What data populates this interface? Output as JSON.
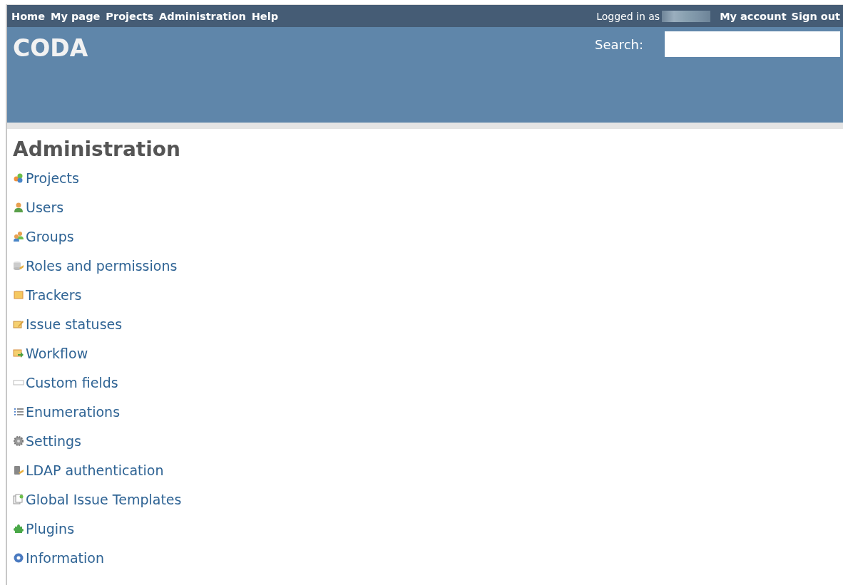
{
  "top_menu": {
    "links": [
      "Home",
      "My page",
      "Projects",
      "Administration",
      "Help"
    ],
    "logged_in_label": "Logged in as",
    "account_links": [
      "My account",
      "Sign out"
    ]
  },
  "header": {
    "title": "CODA",
    "search": {
      "label": "Search:"
    }
  },
  "content": {
    "heading": "Administration",
    "items": [
      {
        "label": "Projects"
      },
      {
        "label": "Users"
      },
      {
        "label": "Groups"
      },
      {
        "label": "Roles and permissions"
      },
      {
        "label": "Trackers"
      },
      {
        "label": "Issue statuses"
      },
      {
        "label": "Workflow"
      },
      {
        "label": "Custom fields"
      },
      {
        "label": "Enumerations"
      },
      {
        "label": "Settings"
      },
      {
        "label": "LDAP authentication"
      },
      {
        "label": "Global Issue Templates"
      },
      {
        "label": "Plugins"
      },
      {
        "label": "Information"
      }
    ]
  }
}
